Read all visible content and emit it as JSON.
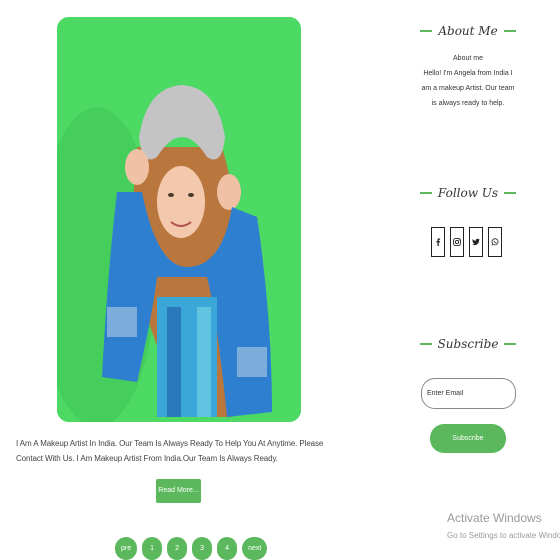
{
  "post": {
    "text": "I Am A Makeup Artist In India. Our Team Is Always Ready To Help You At Anytime. Please Contact With Us. I Am Makeup Artist From India.Our Team Is Always Ready.",
    "read_more_label": "Read More..."
  },
  "pagination": {
    "prev_label": "pre",
    "pages": [
      "1",
      "2",
      "3",
      "4"
    ],
    "next_label": "next"
  },
  "sidebar": {
    "about": {
      "title": "About Me",
      "heading": "About me",
      "body": "Hello! I'm Angela from India I am a makeup Artist. Our team is always ready to help."
    },
    "follow": {
      "title": "Follow Us",
      "icons": [
        "facebook-icon",
        "instagram-icon",
        "twitter-icon",
        "whatsapp-icon"
      ]
    },
    "subscribe": {
      "title": "Subscribe",
      "email_placeholder": "Enter Email",
      "button_label": "Subscribe"
    }
  },
  "watermark": {
    "line1": "Activate Windows",
    "line2": "Go to Settings to activate Windows."
  },
  "colors": {
    "accent": "#5cb85c",
    "photo_background": "#4cd964"
  }
}
